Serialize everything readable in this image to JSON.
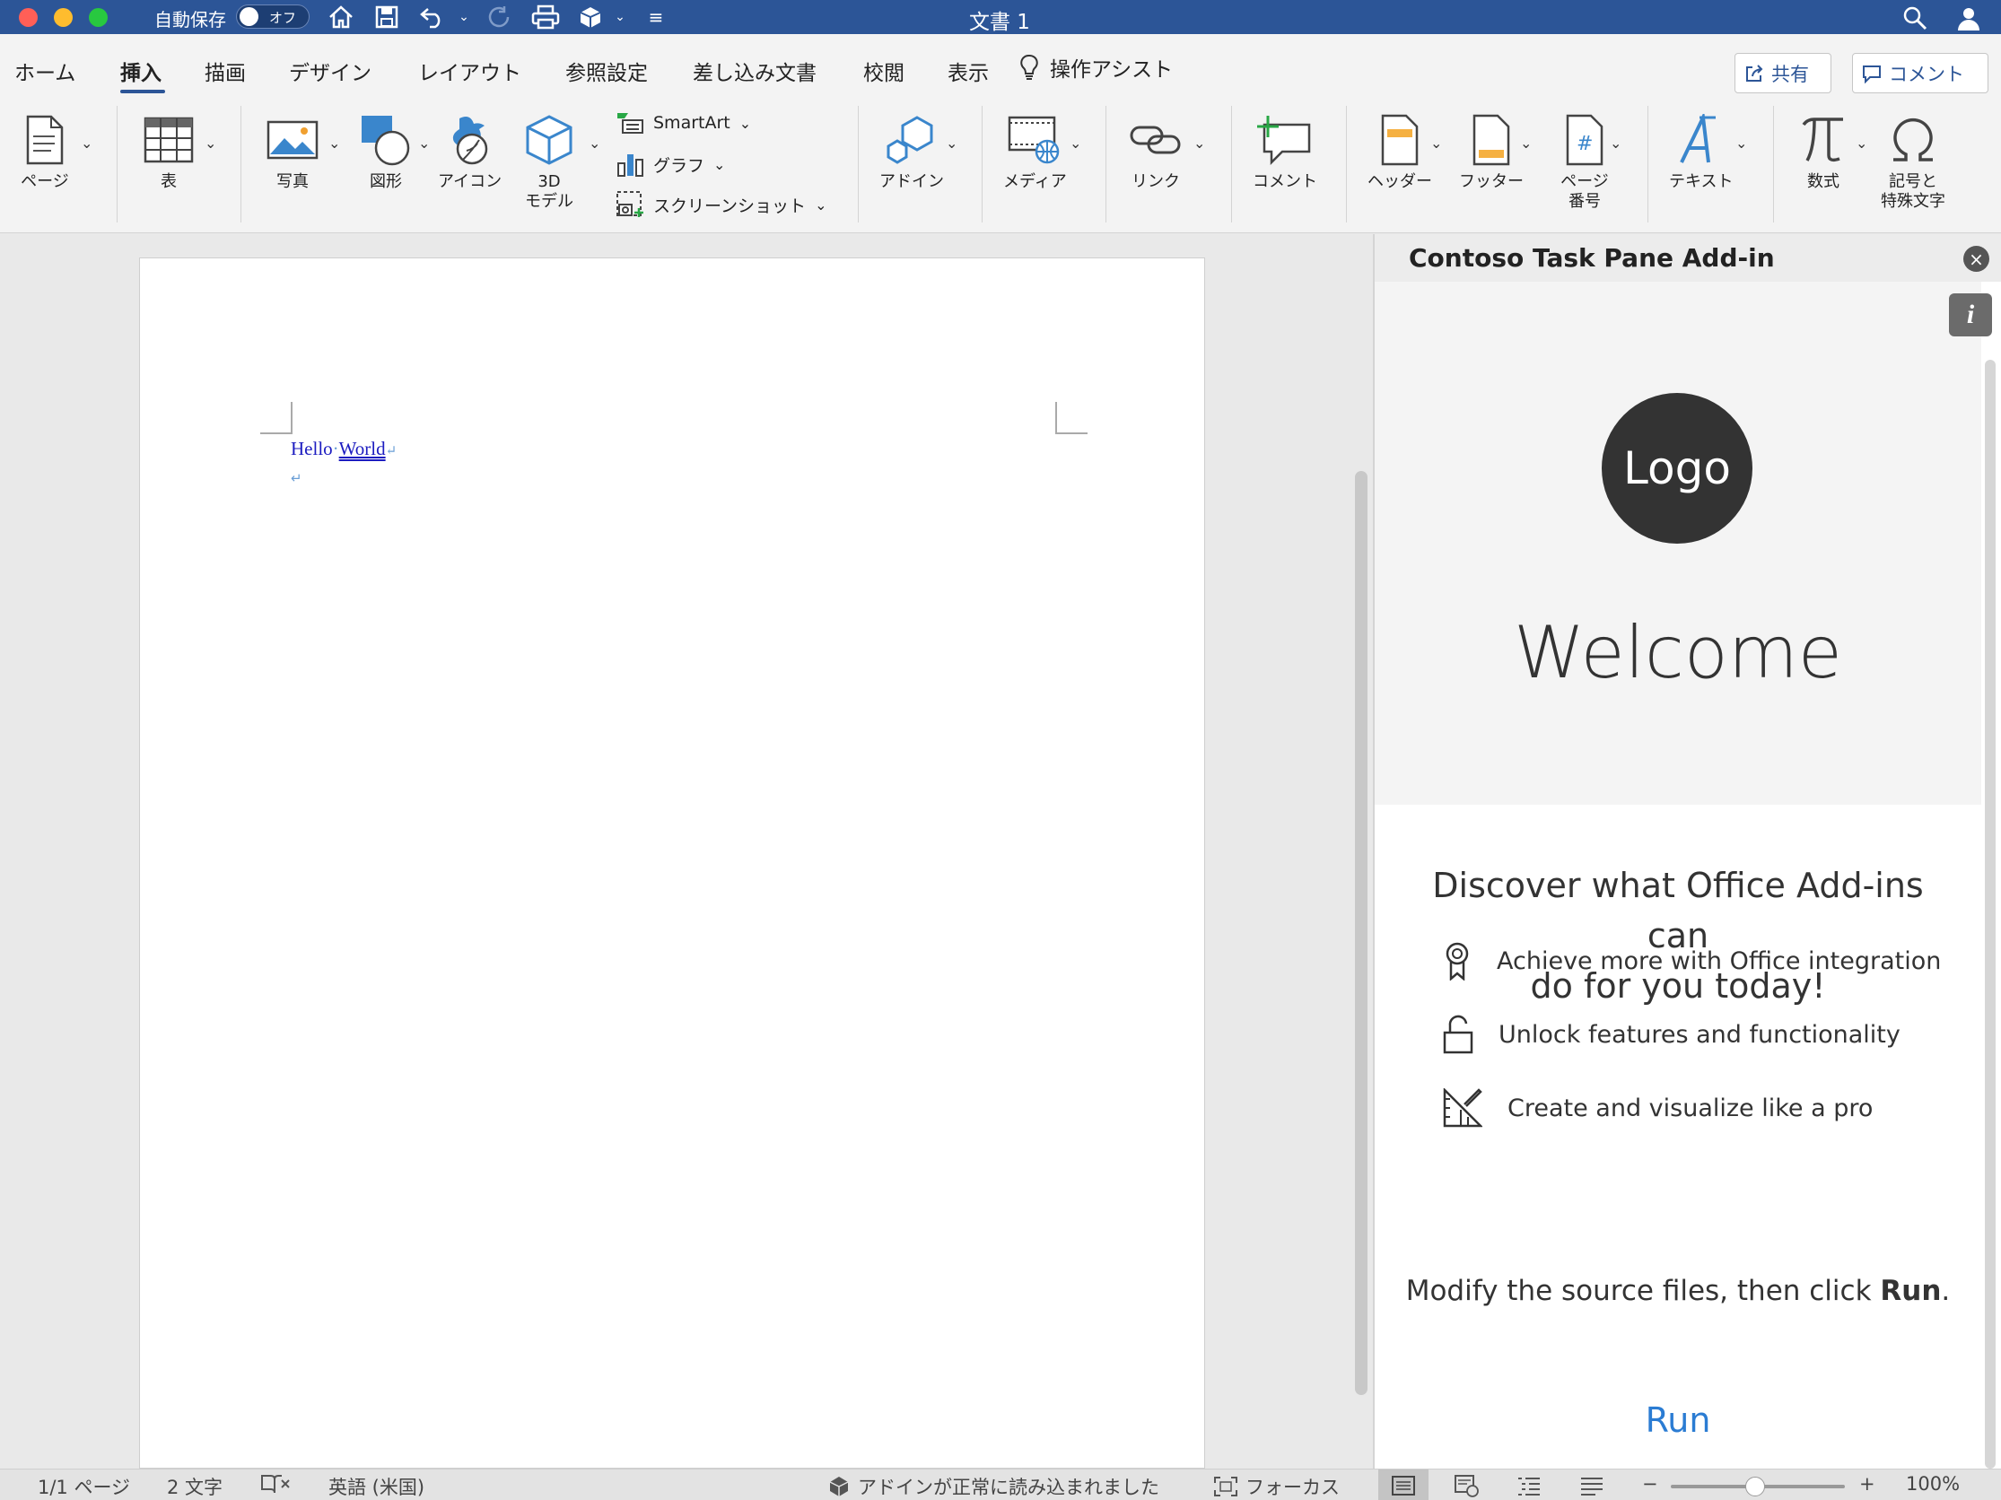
{
  "window": {
    "title": "文書 1",
    "autosave_label": "自動保存",
    "autosave_state": "オフ"
  },
  "tabs": [
    {
      "label": "ホーム"
    },
    {
      "label": "挿入"
    },
    {
      "label": "描画"
    },
    {
      "label": "デザイン"
    },
    {
      "label": "レイアウト"
    },
    {
      "label": "参照設定"
    },
    {
      "label": "差し込み文書"
    },
    {
      "label": "校閲"
    },
    {
      "label": "表示"
    },
    {
      "label": "操作アシスト"
    }
  ],
  "active_tab": "挿入",
  "header_buttons": {
    "share": "共有",
    "comment": "コメント"
  },
  "ribbon": {
    "page": "ページ",
    "table": "表",
    "photo": "写真",
    "shapes": "図形",
    "icons": "アイコン",
    "model3d_line1": "3D",
    "model3d_line2": "モデル",
    "smartart": "SmartArt",
    "chart": "グラフ",
    "screenshot": "スクリーンショット",
    "addins": "アドイン",
    "media": "メディア",
    "link": "リンク",
    "comment": "コメント",
    "header": "ヘッダー",
    "footer": "フッター",
    "page_number_line1": "ページ",
    "page_number_line2": "番号",
    "text": "テキスト",
    "equation": "数式",
    "symbol_line1": "記号と",
    "symbol_line2": "特殊文字"
  },
  "document": {
    "word1": "Hello",
    "word2": "World",
    "para_mark": "↵"
  },
  "task_pane": {
    "title": "Contoso Task Pane Add-in",
    "logo_text": "Logo",
    "welcome": "Welcome",
    "discover_line1": "Discover what Office Add-ins can",
    "discover_line2": "do for you today!",
    "features": [
      {
        "icon": "ribbon-award-icon",
        "text": "Achieve more with Office integration"
      },
      {
        "icon": "unlock-icon",
        "text": "Unlock features and functionality"
      },
      {
        "icon": "design-ideas-icon",
        "text": "Create and visualize like a pro"
      }
    ],
    "modify_prefix": "Modify the source files, then click ",
    "modify_bold": "Run",
    "modify_suffix": ".",
    "run_label": "Run"
  },
  "status_bar": {
    "page_count": "1/1 ページ",
    "word_count": "2 文字",
    "language": "英語 (米国)",
    "addin_status": "アドインが正常に読み込まれました",
    "focus": "フォーカス",
    "zoom_level": "100%",
    "zoom_minus": "−",
    "zoom_plus": "+"
  },
  "colors": {
    "titlebar": "#2c5597",
    "accent": "#2b7cd3",
    "logo_bg": "#333333"
  }
}
